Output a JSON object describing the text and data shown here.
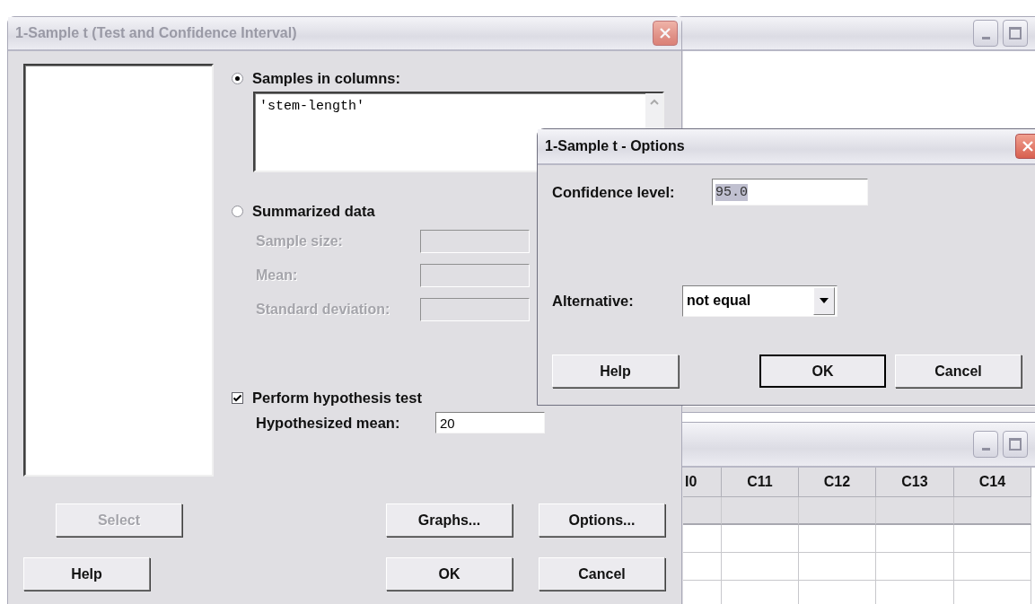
{
  "main_dialog": {
    "title": "1-Sample t (Test and Confidence Interval)",
    "active": false,
    "samples_in_columns": {
      "label": "Samples in columns:",
      "selected": true,
      "value": "'stem-length'"
    },
    "summarized_data": {
      "label": "Summarized data",
      "selected": false,
      "fields": [
        {
          "label": "Sample size:",
          "disabled": true
        },
        {
          "label": "Mean:",
          "disabled": true
        },
        {
          "label": "Standard deviation:",
          "disabled": true
        }
      ]
    },
    "hypothesis_test": {
      "label": "Perform hypothesis test",
      "checked": true,
      "mean_label": "Hypothesized mean:",
      "mean_value": "20"
    },
    "buttons": [
      {
        "label": "Select",
        "disabled": true
      },
      {
        "label": "Graphs...",
        "disabled": false
      },
      {
        "label": "Options...",
        "disabled": false
      },
      {
        "label": "Help",
        "disabled": false
      },
      {
        "label": "OK",
        "disabled": false
      },
      {
        "label": "Cancel",
        "disabled": false
      }
    ]
  },
  "worksheet": {
    "columns": [
      "I0",
      "C11",
      "C12",
      "C13",
      "C14"
    ]
  },
  "options_dialog": {
    "title": "1-Sample t - Options",
    "active": true,
    "confidence_label": "Confidence level:",
    "confidence_value": "95.0",
    "alternative_label": "Alternative:",
    "alternative_value": "not equal",
    "buttons": [
      {
        "label": "Help",
        "default": false
      },
      {
        "label": "OK",
        "default": true
      },
      {
        "label": "Cancel",
        "default": false
      }
    ]
  }
}
